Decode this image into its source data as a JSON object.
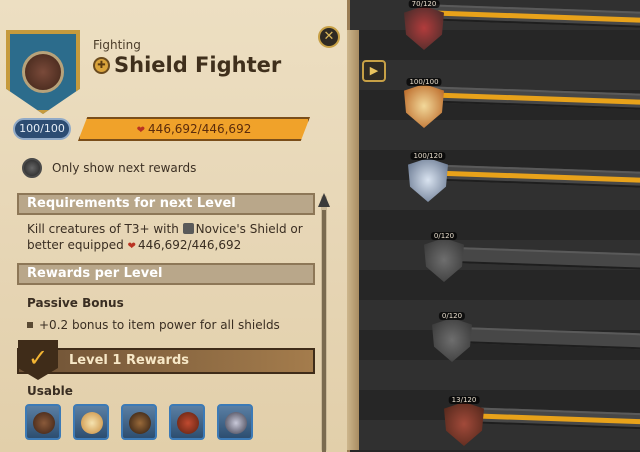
{
  "header": {
    "category": "Fighting",
    "title": "Shield Fighter",
    "close_icon": "close-icon"
  },
  "progress": {
    "level_label": "100/100",
    "fame_value": "446,692/446,692",
    "fill_fraction": 1.0
  },
  "filter": {
    "label": "Only show next rewards"
  },
  "requirements": {
    "header": "Requirements for next Level",
    "line1": "Kill creatures of T3+ with",
    "item_name": "Novice's Shield or",
    "line2": "better equipped",
    "fame_value": "446,692/446,692"
  },
  "rewards_per_level": {
    "header": "Rewards per Level",
    "passive_label": "Passive Bonus",
    "passive_text": "+0.2 bonus to item power for all shields"
  },
  "level_rewards": {
    "header": "Level 1 Rewards",
    "usable_label": "Usable",
    "items": [
      "shield-wooden-icon",
      "shield-sun-icon",
      "shield-dark-icon",
      "shield-cross-icon",
      "shield-crystal-icon"
    ]
  },
  "tree": {
    "nodes": [
      {
        "label": "70/120",
        "top_pct": 0
      },
      {
        "label": "100/100"
      },
      {
        "label": "100/120"
      },
      {
        "label": "0/120"
      },
      {
        "label": "0/120"
      },
      {
        "label": "13/120"
      }
    ]
  },
  "colors": {
    "accent": "#e8a21a",
    "parchment": "#eddfc2",
    "fame_red": "#b93322"
  }
}
